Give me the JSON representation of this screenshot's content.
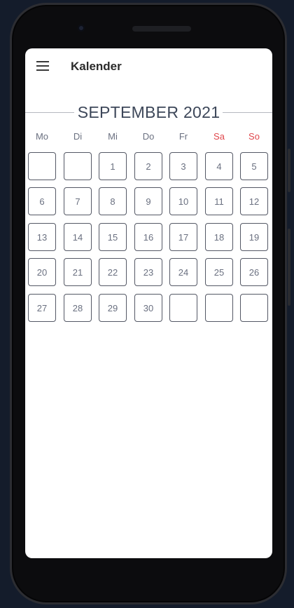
{
  "app": {
    "title": "Kalender"
  },
  "calendar": {
    "month_title": "SEPTEMBER 2021",
    "weekdays": [
      {
        "label": "Mo",
        "weekend": false
      },
      {
        "label": "Di",
        "weekend": false
      },
      {
        "label": "Mi",
        "weekend": false
      },
      {
        "label": "Do",
        "weekend": false
      },
      {
        "label": "Fr",
        "weekend": false
      },
      {
        "label": "Sa",
        "weekend": true
      },
      {
        "label": "So",
        "weekend": true
      }
    ],
    "weeks": [
      [
        "",
        "",
        "1",
        "2",
        "3",
        "4",
        "5"
      ],
      [
        "6",
        "7",
        "8",
        "9",
        "10",
        "11",
        "12"
      ],
      [
        "13",
        "14",
        "15",
        "16",
        "17",
        "18",
        "19"
      ],
      [
        "20",
        "21",
        "22",
        "23",
        "24",
        "25",
        "26"
      ],
      [
        "27",
        "28",
        "29",
        "30",
        "",
        "",
        ""
      ]
    ]
  },
  "colors": {
    "weekend": "#e0474c",
    "month_title": "#3d4759",
    "cell_border": "#545865"
  }
}
